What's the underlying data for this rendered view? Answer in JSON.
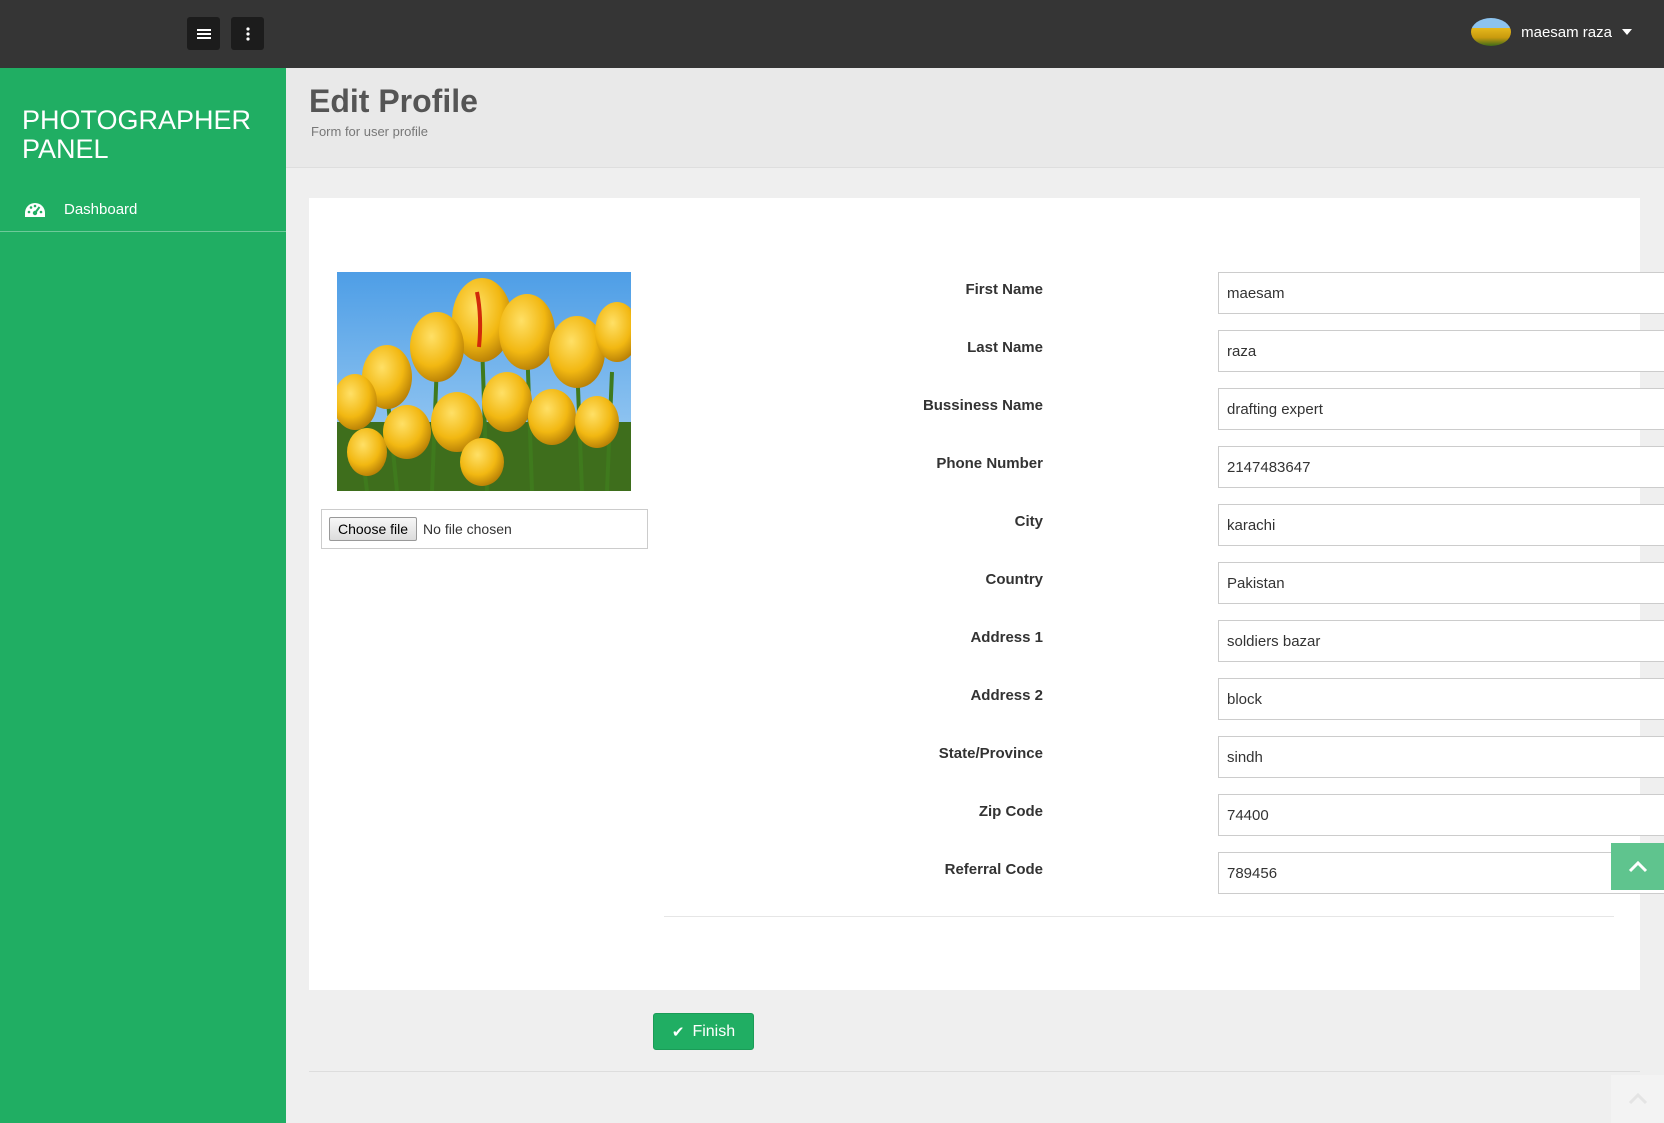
{
  "topbar": {
    "user": {
      "name": "maesam raza"
    },
    "icons": {
      "menu": "hamburger-menu-icon",
      "more": "vertical-ellipsis-icon",
      "caret": "caret-down-icon"
    }
  },
  "sidebar": {
    "brand": "PHOTOGRAPHER PANEL",
    "items": [
      {
        "label": "Dashboard",
        "icon": "dashboard-gauge-icon"
      }
    ]
  },
  "header": {
    "title": "Edit Profile",
    "subtitle": "Form for user profile"
  },
  "profile": {
    "image": "yellow-tulips-photo",
    "file_button": "Choose file",
    "file_status": "No file chosen"
  },
  "form": {
    "fields": [
      {
        "label": "First Name",
        "value": "maesam"
      },
      {
        "label": "Last Name",
        "value": "raza"
      },
      {
        "label": "Bussiness Name",
        "value": "drafting expert"
      },
      {
        "label": "Phone Number",
        "value": "2147483647"
      },
      {
        "label": "City",
        "value": "karachi"
      },
      {
        "label": "Country",
        "value": "Pakistan"
      },
      {
        "label": "Address 1",
        "value": "soldiers bazar"
      },
      {
        "label": "Address 2",
        "value": "block"
      },
      {
        "label": "State/Province",
        "value": "sindh"
      },
      {
        "label": "Zip Code",
        "value": "74400"
      },
      {
        "label": "Referral Code",
        "value": "789456"
      }
    ]
  },
  "actions": {
    "finish_label": "Finish",
    "finish_icon": "check-icon"
  },
  "colors": {
    "accent": "#20ae63",
    "topbar": "#353535",
    "scroll_top": "#5fc48e"
  }
}
